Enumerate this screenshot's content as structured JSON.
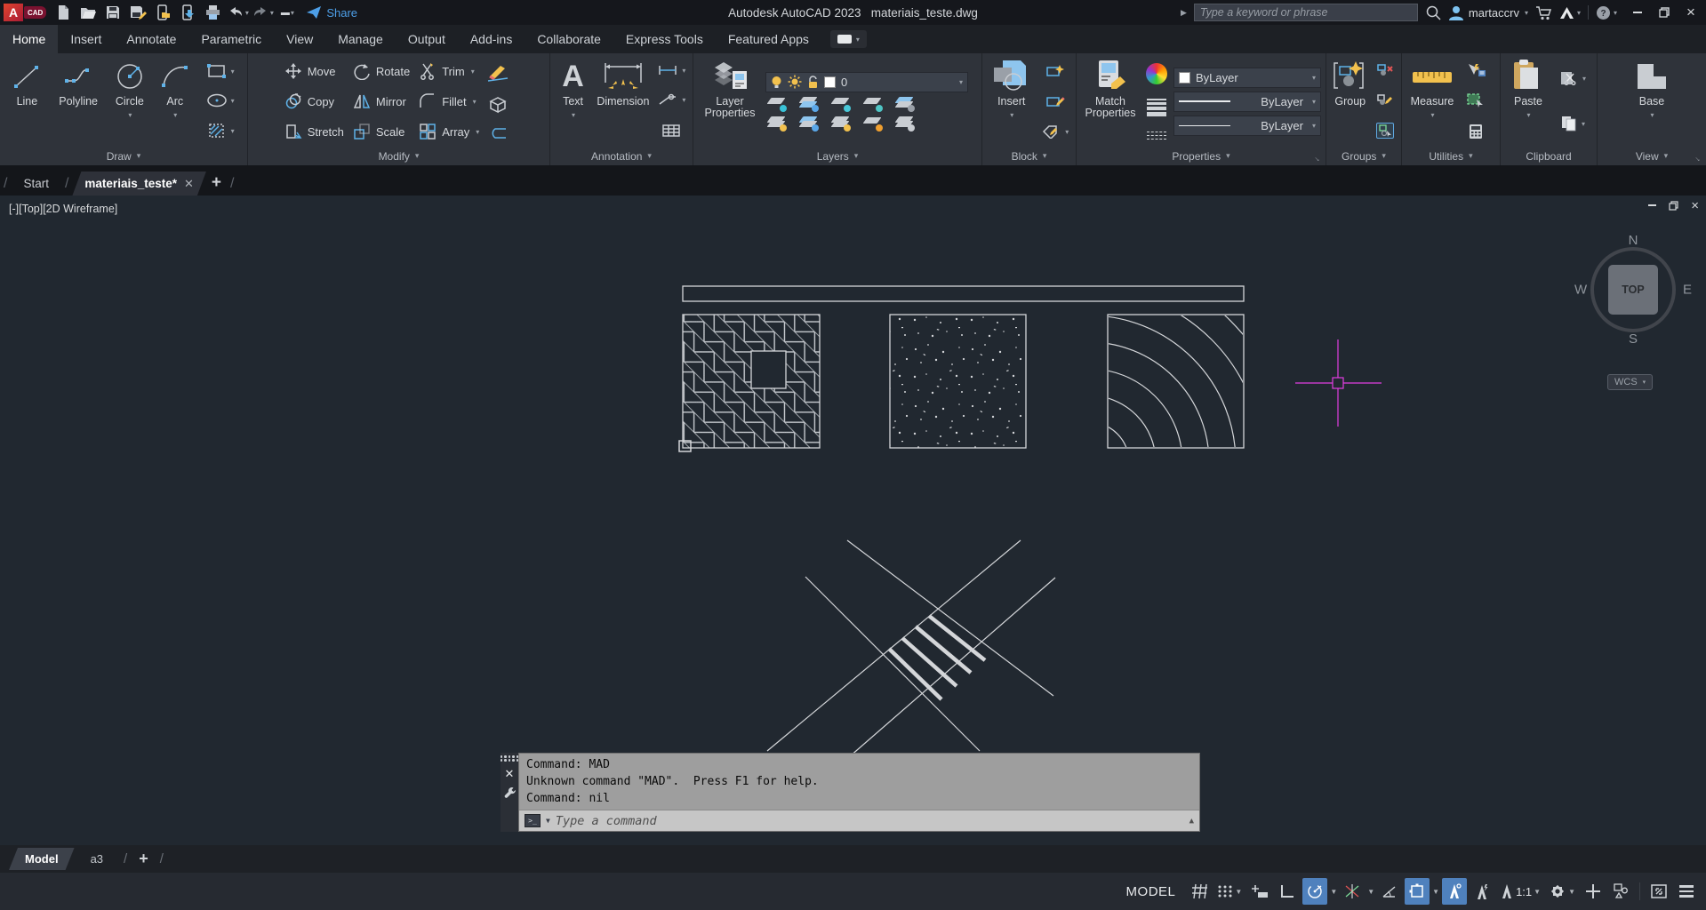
{
  "title_bar": {
    "app_title": "Autodesk AutoCAD 2023",
    "doc_title": "materiais_teste.dwg",
    "share_label": "Share",
    "search_placeholder": "Type a keyword or phrase",
    "username": "martaccrv"
  },
  "ribbon_tabs": [
    {
      "label": "Home",
      "active": true
    },
    {
      "label": "Insert"
    },
    {
      "label": "Annotate"
    },
    {
      "label": "Parametric"
    },
    {
      "label": "View"
    },
    {
      "label": "Manage"
    },
    {
      "label": "Output"
    },
    {
      "label": "Add-ins"
    },
    {
      "label": "Collaborate"
    },
    {
      "label": "Express Tools"
    },
    {
      "label": "Featured Apps"
    }
  ],
  "panels": {
    "draw": {
      "label": "Draw",
      "line": "Line",
      "polyline": "Polyline",
      "circle": "Circle",
      "arc": "Arc"
    },
    "modify": {
      "label": "Modify",
      "move": "Move",
      "copy": "Copy",
      "stretch": "Stretch",
      "rotate": "Rotate",
      "mirror": "Mirror",
      "scale": "Scale",
      "trim": "Trim",
      "fillet": "Fillet",
      "array": "Array"
    },
    "annotation": {
      "label": "Annotation",
      "text": "Text",
      "dimension": "Dimension"
    },
    "layers": {
      "label": "Layers",
      "layer_properties": "Layer Properties",
      "current_layer": "0"
    },
    "block": {
      "label": "Block",
      "insert": "Insert"
    },
    "properties": {
      "label": "Properties",
      "match_properties": "Match Properties",
      "color_value": "ByLayer",
      "lineweight_value": "ByLayer",
      "linetype_value": "ByLayer"
    },
    "groups": {
      "label": "Groups",
      "group": "Group"
    },
    "utilities": {
      "label": "Utilities",
      "measure": "Measure"
    },
    "clipboard": {
      "label": "Clipboard",
      "paste": "Paste"
    },
    "view": {
      "label": "View",
      "base": "Base"
    }
  },
  "file_tabs": {
    "start": "Start",
    "document": "materiais_teste*"
  },
  "viewport": {
    "label": "[-][Top][2D Wireframe]",
    "wcs": "WCS",
    "viewcube": {
      "n": "N",
      "w": "W",
      "s": "S",
      "e": "E",
      "face": "TOP"
    }
  },
  "command_window": {
    "line1": "Command: MAD",
    "line2": "Unknown command \"MAD\".  Press F1 for help.",
    "line3": "Command: nil",
    "input_placeholder": "Type a command"
  },
  "model_tabs": {
    "model": "Model",
    "layout1": "a3"
  },
  "status_bar": {
    "model_badge": "MODEL",
    "annotation_scale": "1:1"
  },
  "colors": {
    "accent_blue": "#4f81bd",
    "magenta_crosshair": "#e23ee2",
    "canvas_bg": "#212830",
    "command_bg": "#9e9e9e",
    "icon_blue": "#5fb2e8",
    "icon_yellow": "#f2c14e"
  }
}
